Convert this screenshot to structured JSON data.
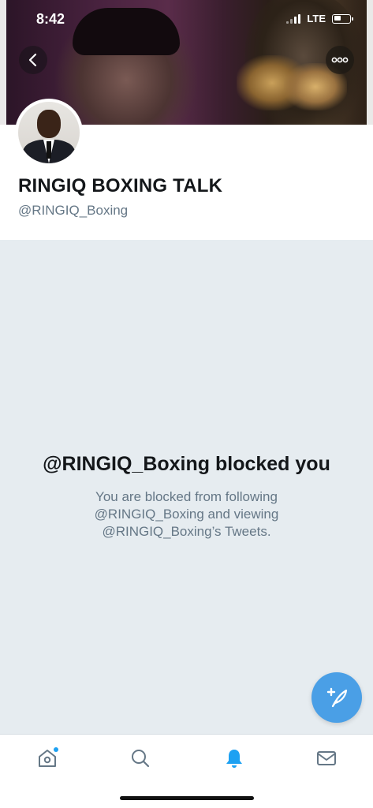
{
  "status_bar": {
    "time": "8:42",
    "network": "LTE",
    "battery_level": 0.35
  },
  "header": {
    "back_icon": "chevron-left-icon",
    "more_icon": "more-dots-icon"
  },
  "profile": {
    "display_name": "RINGIQ BOXING TALK",
    "handle": "@RINGIQ_Boxing"
  },
  "blocked": {
    "title": "@RINGIQ_Boxing blocked you",
    "description": "You are blocked from following @RINGIQ_Boxing and viewing @RINGIQ_Boxing’s Tweets."
  },
  "fab": {
    "icon": "compose-tweet-icon",
    "color": "#4a9fe6"
  },
  "tabbar": {
    "items": [
      {
        "name": "home",
        "icon": "home-icon",
        "has_badge": true
      },
      {
        "name": "search",
        "icon": "search-icon",
        "has_badge": false
      },
      {
        "name": "notifications",
        "icon": "bell-icon",
        "active": true
      },
      {
        "name": "messages",
        "icon": "mail-icon",
        "has_badge": false
      }
    ],
    "active_color": "#1da1f2",
    "inactive_color": "#657786"
  }
}
